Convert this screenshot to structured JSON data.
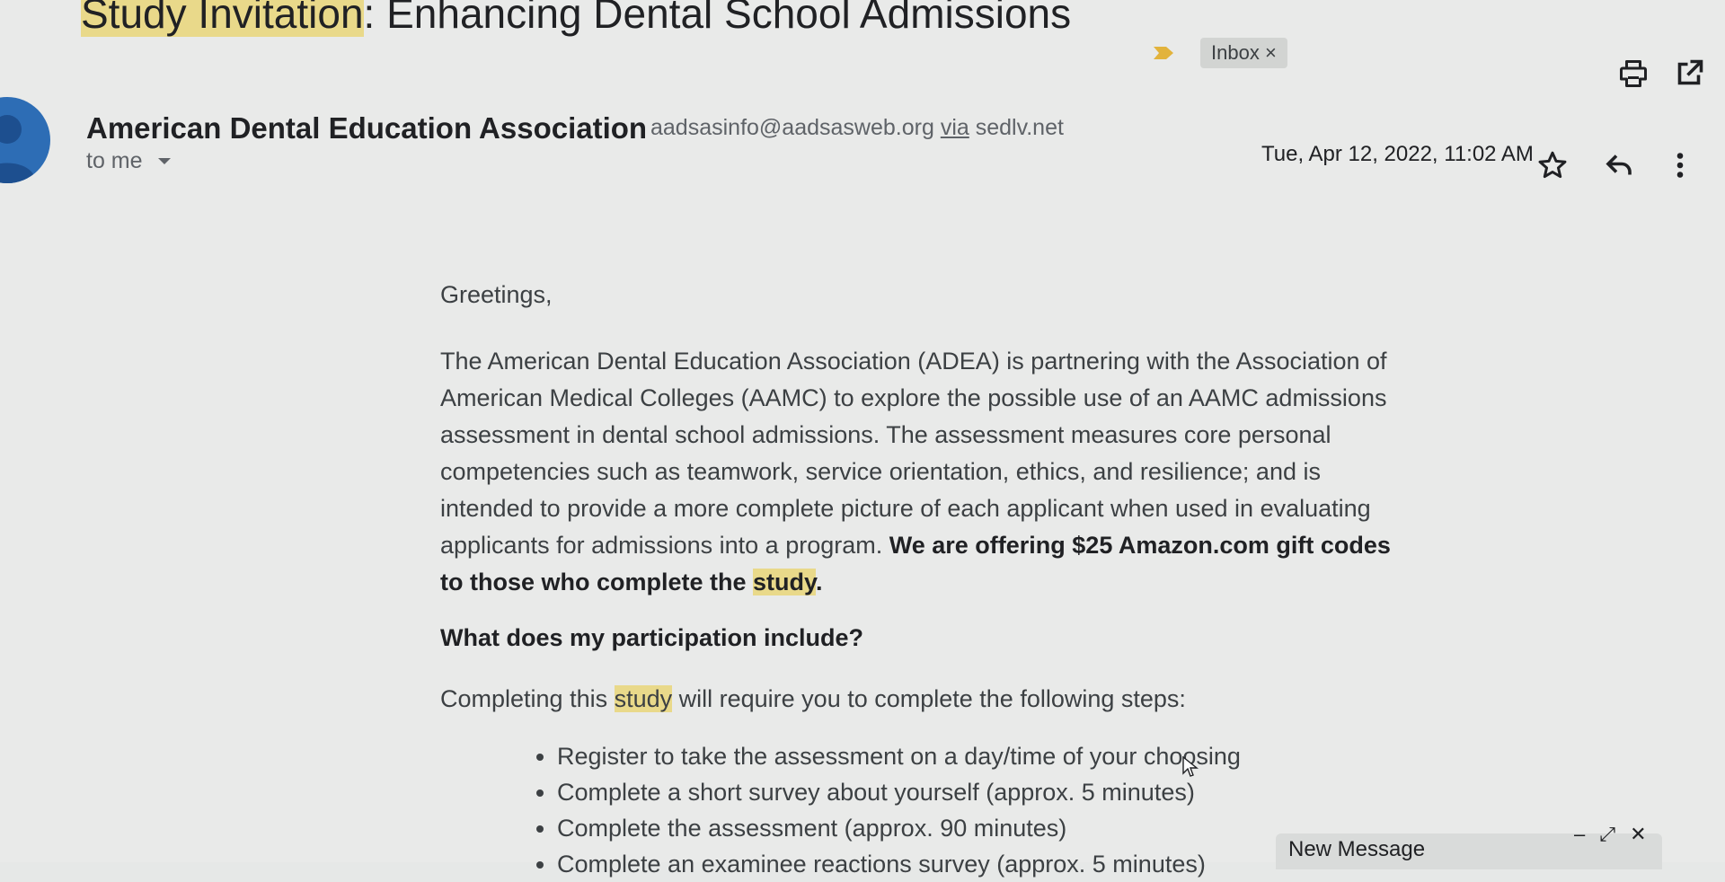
{
  "email": {
    "subject_part1": "Study",
    "subject_part2": " Invitation",
    "subject_part3": ": Enhancing Dental School Admissions",
    "label": "Inbox",
    "label_close": "×",
    "sender_name": "American Dental Education Association",
    "sender_email": "aadsasinfo@aadsasweb.org",
    "via": "via",
    "via_domain": "sedlv.net",
    "to": "to me",
    "date": "Tue, Apr 12, 2022, 11:02 AM"
  },
  "body": {
    "greeting": "Greetings,",
    "paragraph_plain": "The American Dental Education Association (ADEA) is partnering with the Association of American Medical Colleges (AAMC) to explore the possible use of an AAMC admissions assessment in dental school admissions. The assessment measures core personal competencies such as teamwork, service orientation, ethics, and resilience; and is intended to provide a more complete picture of each applicant when used in evaluating applicants for admissions into a program. ",
    "paragraph_bold": "We are offering $25 Amazon.com gift codes to those who complete the ",
    "paragraph_bold_hl": "study",
    "paragraph_bold_end": ".",
    "question": "What does my participation include?",
    "steps_intro_1": "Completing this ",
    "steps_intro_hl": "study",
    "steps_intro_2": " will require you to complete the following steps:",
    "steps": [
      "Register to take the assessment on a day/time of your choosing",
      "Complete a short survey about yourself (approx. 5 minutes)",
      "Complete the assessment (approx. 90 minutes)",
      "Complete an examinee reactions survey (approx. 5 minutes)"
    ]
  },
  "compose": {
    "title": "New Message",
    "minimize": "–",
    "expand": "⤢",
    "close": "✕"
  },
  "icons": {
    "print": "print-icon",
    "open_new_window": "open-in-new-window-icon",
    "star": "star-icon",
    "reply": "reply-icon",
    "more": "more-vertical-icon"
  },
  "colors": {
    "highlight": "#e9d98a",
    "avatar": "#2d6db5",
    "importance_marker": "#e2b33c"
  }
}
